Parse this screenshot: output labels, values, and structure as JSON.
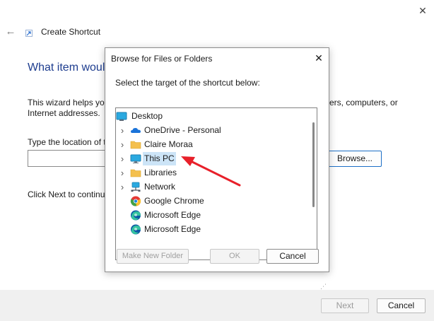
{
  "wizard": {
    "title": "Create Shortcut",
    "heading": "What item woul",
    "description_left_1": "This wizard helps yo",
    "description_left_2": "Internet addresses.",
    "description_right": "ers, computers, or",
    "location_label": "Type the location of t",
    "location_value": "",
    "browse_label": "Browse...",
    "next_info": "Click Next to continu",
    "next_label": "Next",
    "cancel_label": "Cancel"
  },
  "dialog": {
    "title": "Browse for Files or Folders",
    "instruction": "Select the target of the shortcut below:",
    "tree": {
      "root": "Desktop",
      "items": [
        {
          "label": "OneDrive - Personal",
          "icon": "onedrive-cloud-icon",
          "expandable": true
        },
        {
          "label": "Claire Moraa",
          "icon": "folder-icon",
          "expandable": true
        },
        {
          "label": "This PC",
          "icon": "monitor-icon",
          "expandable": true,
          "selected": true
        },
        {
          "label": "Libraries",
          "icon": "folder-icon",
          "expandable": true
        },
        {
          "label": "Network",
          "icon": "network-icon",
          "expandable": true
        },
        {
          "label": "Google Chrome",
          "icon": "chrome-icon",
          "expandable": false
        },
        {
          "label": "Microsoft Edge",
          "icon": "edge-icon",
          "expandable": false
        },
        {
          "label": "Microsoft Edge",
          "icon": "edge-icon",
          "expandable": false
        }
      ]
    },
    "make_folder_label": "Make New Folder",
    "ok_label": "OK",
    "cancel_label": "Cancel"
  },
  "colors": {
    "heading": "#1e3d8f",
    "accent_border": "#1c6fc6",
    "selection": "#cce4f7",
    "annotation_arrow": "#e8202a"
  }
}
